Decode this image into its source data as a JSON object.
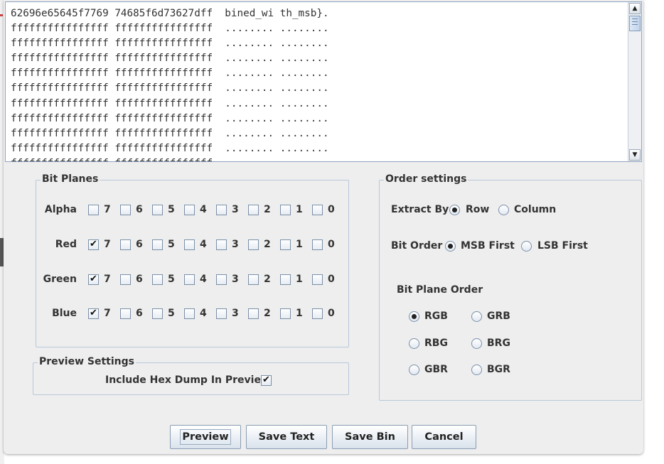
{
  "hex_dump": {
    "lines": [
      "62696e65645f7769 74685f6d73627dff  bined_wi th_msb}.",
      "ffffffffffffffff ffffffffffffffff  ........ ........",
      "ffffffffffffffff ffffffffffffffff  ........ ........",
      "ffffffffffffffff ffffffffffffffff  ........ ........",
      "ffffffffffffffff ffffffffffffffff  ........ ........",
      "ffffffffffffffff ffffffffffffffff  ........ ........",
      "ffffffffffffffff ffffffffffffffff  ........ ........",
      "ffffffffffffffff ffffffffffffffff  ........ ........",
      "ffffffffffffffff ffffffffffffffff  ........ ........",
      "ffffffffffffffff ffffffffffffffff  ........ ........",
      "ffffffffffffffff ffffffffffffffff  ........ ........"
    ]
  },
  "bit_planes": {
    "title": "Bit Planes",
    "bits": [
      "7",
      "6",
      "5",
      "4",
      "3",
      "2",
      "1",
      "0"
    ],
    "rows": [
      {
        "label": "Alpha",
        "checked": [
          false,
          false,
          false,
          false,
          false,
          false,
          false,
          false
        ]
      },
      {
        "label": "Red",
        "checked": [
          true,
          false,
          false,
          false,
          false,
          false,
          false,
          false
        ]
      },
      {
        "label": "Green",
        "checked": [
          true,
          false,
          false,
          false,
          false,
          false,
          false,
          false
        ]
      },
      {
        "label": "Blue",
        "checked": [
          true,
          false,
          false,
          false,
          false,
          false,
          false,
          false
        ]
      }
    ]
  },
  "preview_settings": {
    "title": "Preview Settings",
    "include_hex_label": "Include Hex Dump In Preview",
    "include_hex_checked": true
  },
  "order_settings": {
    "title": "Order settings",
    "extract_by": {
      "label": "Extract By",
      "options": [
        "Row",
        "Column"
      ],
      "selected": "Row"
    },
    "bit_order": {
      "label": "Bit Order",
      "options": [
        "MSB First",
        "LSB First"
      ],
      "selected": "MSB First"
    },
    "bit_plane_order": {
      "label": "Bit Plane Order",
      "options": [
        "RGB",
        "GRB",
        "RBG",
        "BRG",
        "GBR",
        "BGR"
      ],
      "selected": "RGB"
    }
  },
  "buttons": {
    "preview": "Preview",
    "save_text": "Save Text",
    "save_bin": "Save Bin",
    "cancel": "Cancel"
  },
  "colors": {
    "dialog_bg": "#eeeeee",
    "group_border": "#b8c8da",
    "text": "#333333"
  }
}
